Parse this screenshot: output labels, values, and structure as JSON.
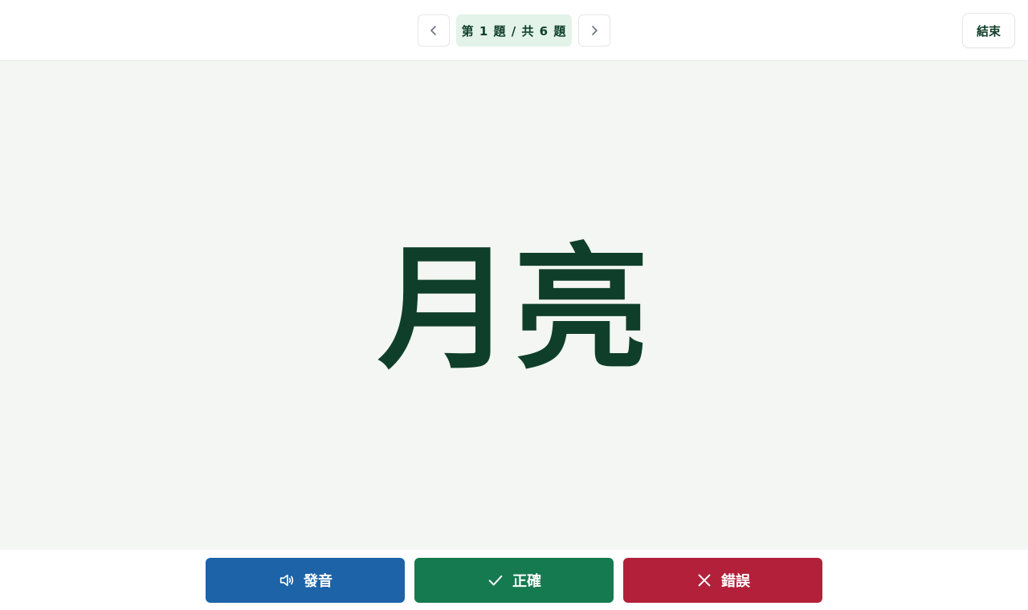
{
  "header": {
    "prev_icon": "chevron-left-icon",
    "progress_label": "第 1 題 / 共 6 題",
    "next_icon": "chevron-right-icon",
    "end_label": "結束"
  },
  "card": {
    "word": "月亮"
  },
  "actions": {
    "sound_label": "發音",
    "sound_icon": "speaker-icon",
    "correct_label": "正確",
    "correct_icon": "check-icon",
    "wrong_label": "錯誤",
    "wrong_icon": "close-icon"
  },
  "colors": {
    "brand_dark_green": "#0f3f2a",
    "sound_blue": "#1c63a8",
    "correct_green": "#157a4f",
    "wrong_red": "#b3203a",
    "progress_pill_bg": "#e3f3ea",
    "card_bg": "#f3f6f2"
  }
}
